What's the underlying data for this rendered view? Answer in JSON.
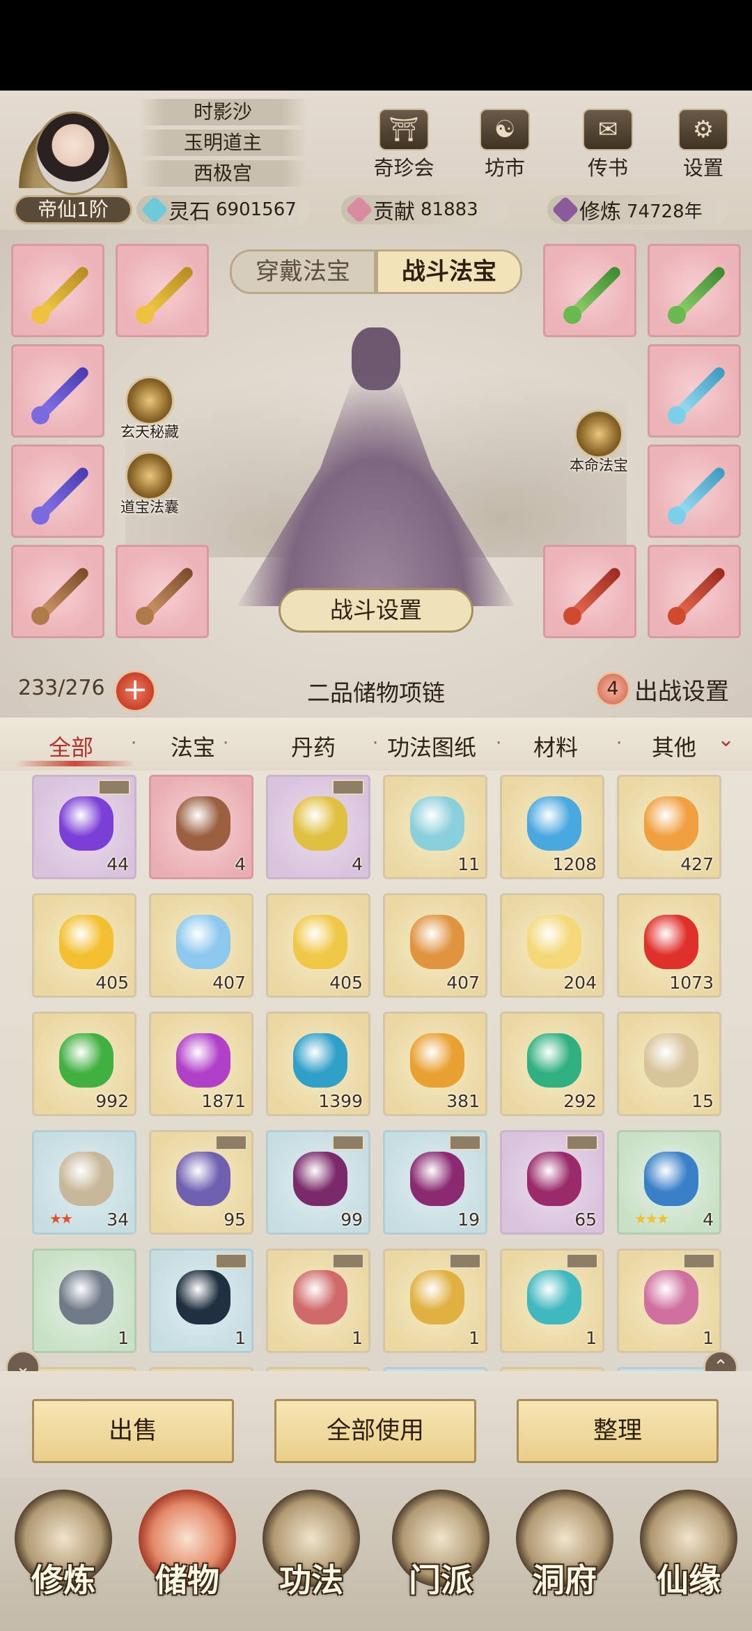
{
  "player": {
    "name": "时影沙",
    "title": "玉明道主",
    "sect": "西极宫",
    "rank": "帝仙1阶"
  },
  "top_buttons": [
    {
      "label": "奇珍会",
      "icon": "treasure-pavilion-icon"
    },
    {
      "label": "坊市",
      "icon": "market-icon"
    },
    {
      "label": "传书",
      "icon": "scroll-letter-icon"
    },
    {
      "label": "设置",
      "icon": "gear-icon"
    }
  ],
  "resources": {
    "spirit_stone": {
      "label": "灵石",
      "value": "6901567",
      "color": "#6ec9d8"
    },
    "contribution": {
      "label": "贡献",
      "value": "81883",
      "color": "#d98ba0"
    },
    "cultivation": {
      "label": "修炼",
      "value": "74728年",
      "color": "#8a5a9a"
    }
  },
  "treasure_tabs": {
    "wear": "穿戴法宝",
    "battle": "战斗法宝",
    "active": "battle"
  },
  "side_icons": {
    "xuantian": "玄天秘藏",
    "daobao": "道宝法囊",
    "benming": "本命法宝"
  },
  "battle_setting_label": "战斗设置",
  "capacity": {
    "count": "233/276",
    "name": "二品储物项链",
    "deploy_count": "4",
    "deploy_label": "出战设置"
  },
  "categories": [
    "全部",
    "法宝",
    "丹药",
    "功法图纸",
    "材料",
    "其他"
  ],
  "active_category": "全部",
  "items": [
    {
      "qty": "44",
      "bg": "purple",
      "color": "#7a3fd6",
      "tag": true
    },
    {
      "qty": "4",
      "bg": "red",
      "color": "#9a6040",
      "tag": false
    },
    {
      "qty": "4",
      "bg": "purple",
      "color": "#e0c040",
      "tag": true
    },
    {
      "qty": "11",
      "bg": "gold",
      "color": "#8ad0dc",
      "tag": false
    },
    {
      "qty": "1208",
      "bg": "gold",
      "color": "#4aa8e0",
      "tag": false
    },
    {
      "qty": "427",
      "bg": "gold",
      "color": "#f0a040",
      "tag": false
    },
    {
      "qty": "405",
      "bg": "gold",
      "color": "#f2c030",
      "tag": false
    },
    {
      "qty": "407",
      "bg": "gold",
      "color": "#8cc8ee",
      "tag": false
    },
    {
      "qty": "405",
      "bg": "gold",
      "color": "#f0c848",
      "tag": false
    },
    {
      "qty": "407",
      "bg": "gold",
      "color": "#e09440",
      "tag": false
    },
    {
      "qty": "204",
      "bg": "gold",
      "color": "#f4d878",
      "tag": false
    },
    {
      "qty": "1073",
      "bg": "gold",
      "color": "#e0302a",
      "tag": false
    },
    {
      "qty": "992",
      "bg": "gold",
      "color": "#40b040",
      "tag": false
    },
    {
      "qty": "1871",
      "bg": "gold",
      "color": "#b040c8",
      "tag": false
    },
    {
      "qty": "1399",
      "bg": "gold",
      "color": "#30a0c8",
      "tag": false
    },
    {
      "qty": "381",
      "bg": "gold",
      "color": "#e8a030",
      "tag": false
    },
    {
      "qty": "292",
      "bg": "gold",
      "color": "#30b080",
      "tag": false
    },
    {
      "qty": "15",
      "bg": "gold",
      "color": "#d8c49a",
      "tag": false
    },
    {
      "qty": "34",
      "bg": "blue",
      "color": "#c8b89a",
      "tag": false,
      "stars": "★★"
    },
    {
      "qty": "95",
      "bg": "gold",
      "color": "#7060b0",
      "tag": true
    },
    {
      "qty": "99",
      "bg": "blue",
      "color": "#7a2a6a",
      "tag": true
    },
    {
      "qty": "19",
      "bg": "blue",
      "color": "#8a2a70",
      "tag": true
    },
    {
      "qty": "65",
      "bg": "purple",
      "color": "#9a2a6a",
      "tag": true
    },
    {
      "qty": "4",
      "bg": "green",
      "color": "#3a80c8",
      "tag": false,
      "stars": "★★★"
    },
    {
      "qty": "1",
      "bg": "green",
      "color": "#707a88",
      "tag": false
    },
    {
      "qty": "1",
      "bg": "blue",
      "color": "#203040",
      "tag": true
    },
    {
      "qty": "1",
      "bg": "gold",
      "color": "#d06a6a",
      "tag": true
    },
    {
      "qty": "1",
      "bg": "gold",
      "color": "#e0b040",
      "tag": true
    },
    {
      "qty": "1",
      "bg": "gold",
      "color": "#40b8c0",
      "tag": true
    },
    {
      "qty": "1",
      "bg": "gold",
      "color": "#d070a0",
      "tag": true
    }
  ],
  "actions": {
    "sell": "出售",
    "use_all": "全部使用",
    "organize": "整理"
  },
  "nav": [
    {
      "label": "修炼",
      "icon": "cultivate-icon"
    },
    {
      "label": "储物",
      "icon": "storage-bag-icon",
      "active": true
    },
    {
      "label": "功法",
      "icon": "technique-scroll-icon"
    },
    {
      "label": "门派",
      "icon": "sect-gate-icon"
    },
    {
      "label": "洞府",
      "icon": "cave-dwelling-icon"
    },
    {
      "label": "仙缘",
      "icon": "immortal-fate-icon"
    }
  ]
}
